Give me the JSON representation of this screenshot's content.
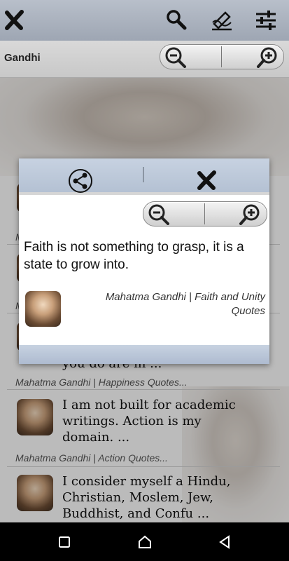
{
  "app": {
    "title": "Gandhi"
  },
  "zoom": {
    "minus_icon": "zoom-out-icon",
    "plus_icon": "zoom-in-icon"
  },
  "topbar": {
    "icons": [
      "close-icon",
      "search-icon",
      "write-icon",
      "sliders-icon"
    ]
  },
  "list": {
    "meta_top_1": "M",
    "meta_top_2": "M",
    "partial_line": "you do are in ...",
    "meta_1": "Mahatma Gandhi | Happiness Quotes...",
    "item_2_text": "I am not built for academic writings. Action is my domain. ...",
    "item_2_meta": "Mahatma Gandhi | Action Quotes...",
    "item_3_text": "I consider myself a Hindu, Christian, Moslem, Jew, Buddhist, and Confu ..."
  },
  "dialog": {
    "quote": "Faith is not something to grasp, it is a state to grow into.",
    "author": "Mahatma Gandhi | Faith and Unity Quotes"
  },
  "colors": {
    "header": "#b4c1d3",
    "overlay": "rgba(0,0,0,0.25)"
  }
}
